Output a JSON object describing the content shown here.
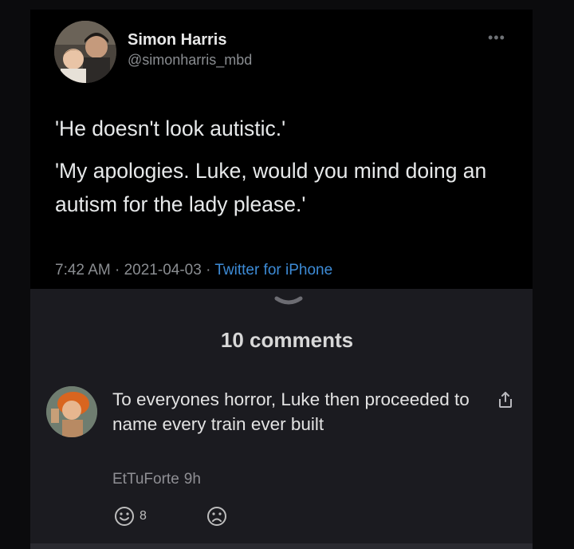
{
  "tweet": {
    "author_name": "Simon Harris",
    "author_handle": "@simonharris_mbd",
    "more_icon": "more-dots-icon",
    "lines": [
      "'He doesn't look autistic.'",
      "'My apologies. Luke, would you mind doing an autism for the lady please.'"
    ],
    "time": "7:42 AM · 2021-04-03 · ",
    "app": "Twitter for iPhone"
  },
  "comments_header": "10 comments",
  "comment": {
    "text": "To everyones horror, Luke then proceeded to name every train ever built",
    "username": "EtTuForte",
    "age": "9h",
    "happy_count": "8",
    "share_icon": "share-icon"
  },
  "colors": {
    "background": "#0b0b0d",
    "panel": "#1b1b20",
    "tweet_bg": "#000000",
    "link": "#3d8bd6"
  }
}
